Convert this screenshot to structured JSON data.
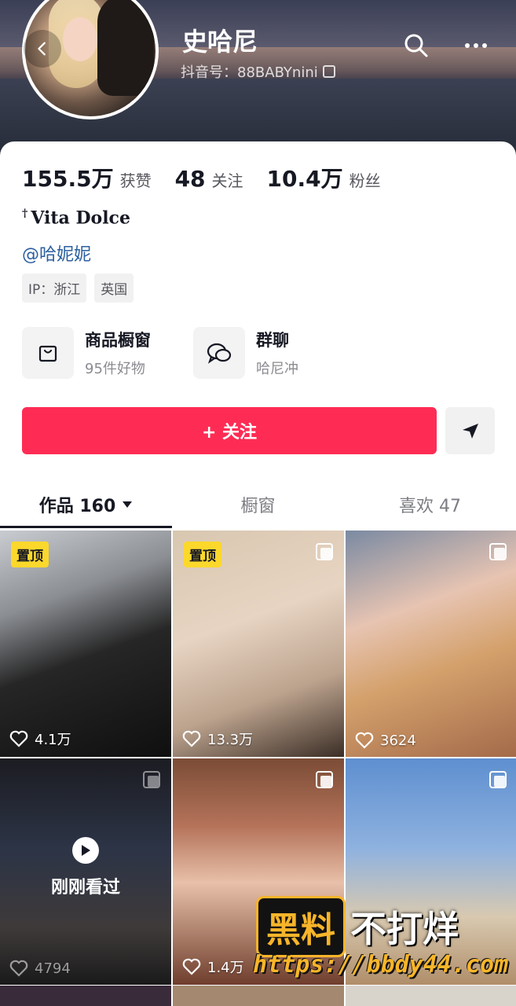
{
  "header": {
    "nickname": "史哈尼",
    "douyin_id": "抖音号：88BABYnini"
  },
  "stats": [
    {
      "num": "155.5万",
      "label": "获赞"
    },
    {
      "num": "48",
      "label": "关注"
    },
    {
      "num": "10.4万",
      "label": "粉丝"
    }
  ],
  "bio": {
    "line": "Vita Dolce",
    "prefix": "†",
    "mention": "@哈妮妮"
  },
  "tags": [
    "IP：浙江",
    "英国"
  ],
  "shortcuts": [
    {
      "title": "商品橱窗",
      "sub": "95件好物"
    },
    {
      "title": "群聊",
      "sub": "哈尼冲"
    }
  ],
  "follow": {
    "label": "+ 关注"
  },
  "tabs": [
    {
      "label": "作品 160"
    },
    {
      "label": "橱窗"
    },
    {
      "label": "喜欢 47"
    }
  ],
  "videos": [
    {
      "pinned": "置顶",
      "likes": "4.1万"
    },
    {
      "pinned": "置顶",
      "likes": "13.3万"
    },
    {
      "likes": "3624"
    },
    {
      "likes": "4794",
      "watched": "刚刚看过"
    },
    {
      "likes": "1.4万"
    },
    {
      "likes": ""
    }
  ],
  "watermark": {
    "left": "黑料",
    "right": "不打烊",
    "url": "https://bbdy44.com"
  },
  "colors": {
    "accent": "#fe2c55",
    "link": "#2b5f9e",
    "pin": "#fbd82b"
  }
}
